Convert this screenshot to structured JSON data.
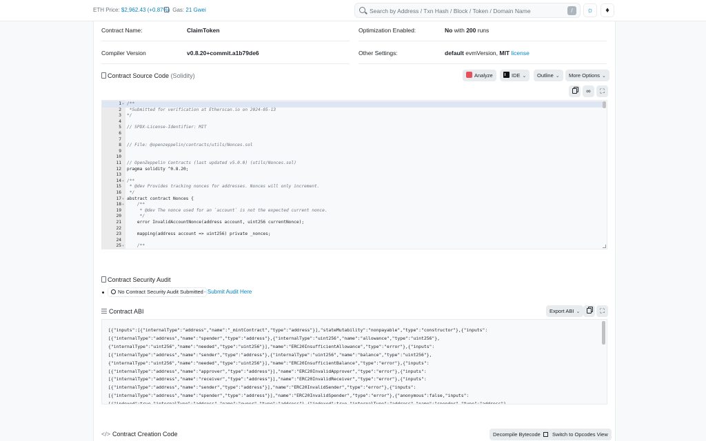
{
  "header": {
    "eth_price_label": "ETH Price:",
    "eth_price_value": "$2,962.43 (+0.87%)",
    "gas_label": "Gas:",
    "gas_value": "21 Gwei",
    "search_placeholder": "Search by Address / Txn Hash / Block / Token / Domain Name",
    "search_shortcut": "/",
    "theme_icon": "sun-icon",
    "network_icon": "ethereum-icon"
  },
  "contract_info": {
    "name_label": "Contract Name:",
    "name_value": "ClaimToken",
    "compiler_label": "Compiler Version",
    "compiler_value": "v0.8.20+commit.a1b79de6",
    "optimization_label": "Optimization Enabled:",
    "optimization_value_bold1": "No",
    "optimization_value_mid": " with ",
    "optimization_value_bold2": "200",
    "optimization_value_end": " runs",
    "other_label": "Other Settings:",
    "other_value_bold": "default",
    "other_value_mid": " evmVersion, ",
    "other_value_bold2": "MIT",
    "other_value_link": "license"
  },
  "source_code": {
    "title": "Contract Source Code",
    "subtitle": "(Solidity)",
    "analyze_label": "Analyze",
    "ide_label": "IDE",
    "outline_label": "Outline",
    "more_options_label": "More Options",
    "lines": [
      {
        "n": "1",
        "fold": "▾",
        "t": "/**",
        "k": "comment"
      },
      {
        "n": "2",
        "fold": "",
        "t": " *Submitted for verification at Etherscan.io on 2024-05-13",
        "k": "comment"
      },
      {
        "n": "3",
        "fold": "",
        "t": "*/",
        "k": "comment"
      },
      {
        "n": "4",
        "fold": "",
        "t": "",
        "k": "plain"
      },
      {
        "n": "5",
        "fold": "",
        "t": "// SPDX-License-Identifier: MIT",
        "k": "comment"
      },
      {
        "n": "6",
        "fold": "",
        "t": "",
        "k": "plain"
      },
      {
        "n": "7",
        "fold": "",
        "t": "",
        "k": "plain"
      },
      {
        "n": "8",
        "fold": "",
        "t": "// File: @openzeppelin/contracts/utils/Nonces.sol",
        "k": "comment"
      },
      {
        "n": "9",
        "fold": "",
        "t": "",
        "k": "plain"
      },
      {
        "n": "10",
        "fold": "",
        "t": "",
        "k": "plain"
      },
      {
        "n": "11",
        "fold": "",
        "t": "// OpenZeppelin Contracts (last updated v5.0.0) (utils/Nonces.sol)",
        "k": "comment"
      },
      {
        "n": "12",
        "fold": "",
        "t": "pragma solidity ^0.8.20;",
        "k": "plain"
      },
      {
        "n": "13",
        "fold": "",
        "t": "",
        "k": "plain"
      },
      {
        "n": "14",
        "fold": "▾",
        "t": "/**",
        "k": "comment"
      },
      {
        "n": "15",
        "fold": "",
        "t": " * @dev Provides tracking nonces for addresses. Nonces will only increment.",
        "k": "comment"
      },
      {
        "n": "16",
        "fold": "",
        "t": " */",
        "k": "comment"
      },
      {
        "n": "17",
        "fold": "▾",
        "t": "abstract contract Nonces {",
        "k": "plain"
      },
      {
        "n": "18",
        "fold": "▾",
        "t": "    /**",
        "k": "comment"
      },
      {
        "n": "19",
        "fold": "",
        "t": "     * @dev The nonce used for an `account` is not the expected current nonce.",
        "k": "comment"
      },
      {
        "n": "20",
        "fold": "",
        "t": "     */",
        "k": "comment"
      },
      {
        "n": "21",
        "fold": "",
        "t": "    error InvalidAccountNonce(address account, uint256 currentNonce);",
        "k": "plain"
      },
      {
        "n": "22",
        "fold": "",
        "t": "",
        "k": "plain"
      },
      {
        "n": "23",
        "fold": "",
        "t": "    mapping(address account => uint256) private _nonces;",
        "k": "plain"
      },
      {
        "n": "24",
        "fold": "",
        "t": "",
        "k": "plain"
      },
      {
        "n": "25",
        "fold": "▾",
        "t": "    /**",
        "k": "comment"
      }
    ]
  },
  "audit": {
    "title": "Contract Security Audit",
    "badge": "No Contract Security Audit Submitted",
    "link": "- Submit Audit Here"
  },
  "abi": {
    "title": "Contract ABI",
    "export_label": "Export ABI",
    "lines": [
      "[{\"inputs\":[{\"internalType\":\"address\",\"name\":\"_mintContract\",\"type\":\"address\"}],\"stateMutability\":\"nonpayable\",\"type\":\"constructor\"},{\"inputs\":",
      "[{\"internalType\":\"address\",\"name\":\"spender\",\"type\":\"address\"},{\"internalType\":\"uint256\",\"name\":\"allowance\",\"type\":\"uint256\"},",
      "{\"internalType\":\"uint256\",\"name\":\"needed\",\"type\":\"uint256\"}],\"name\":\"ERC20InsufficientAllowance\",\"type\":\"error\"},{\"inputs\":",
      "[{\"internalType\":\"address\",\"name\":\"sender\",\"type\":\"address\"},{\"internalType\":\"uint256\",\"name\":\"balance\",\"type\":\"uint256\"},",
      "{\"internalType\":\"uint256\",\"name\":\"needed\",\"type\":\"uint256\"}],\"name\":\"ERC20InsufficientBalance\",\"type\":\"error\"},{\"inputs\":",
      "[{\"internalType\":\"address\",\"name\":\"approver\",\"type\":\"address\"}],\"name\":\"ERC20InvalidApprover\",\"type\":\"error\"},{\"inputs\":",
      "[{\"internalType\":\"address\",\"name\":\"receiver\",\"type\":\"address\"}],\"name\":\"ERC20InvalidReceiver\",\"type\":\"error\"},{\"inputs\":",
      "[{\"internalType\":\"address\",\"name\":\"sender\",\"type\":\"address\"}],\"name\":\"ERC20InvalidSender\",\"type\":\"error\"},{\"inputs\":",
      "[{\"internalType\":\"address\",\"name\":\"spender\",\"type\":\"address\"}],\"name\":\"ERC20InvalidSpender\",\"type\":\"error\"},{\"anonymous\":false,\"inputs\":",
      "[{\"indexed\":true,\"internalType\":\"address\",\"name\":\"owner\",\"type\":\"address\"},{\"indexed\":true,\"internalType\":\"address\",\"name\":\"spender\",\"type\":\"address\"},"
    ]
  },
  "creation_code": {
    "title": "Contract Creation Code",
    "decompile_label": "Decompile Bytecode",
    "opcodes_label": "Switch to Opcodes View"
  },
  "colors": {
    "accent": "#0784c3",
    "muted": "#6c757d",
    "comment": "#6a737d",
    "keyword": "#6f42c1"
  }
}
